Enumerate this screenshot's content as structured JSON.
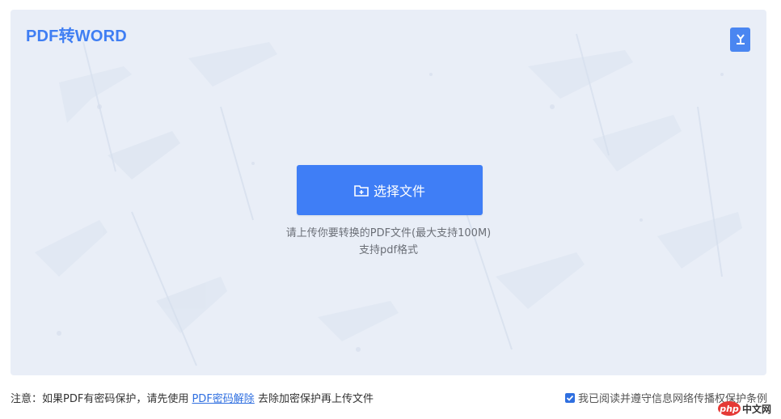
{
  "header": {
    "title": "PDF转WORD"
  },
  "upload": {
    "button_label": "选择文件",
    "hint_line1": "请上传你要转换的PDF文件(最大支持100M)",
    "hint_line2": "支持pdf格式"
  },
  "footer": {
    "notice_prefix": "注意：如果PDF有密码保护，请先使用",
    "notice_link": "PDF密码解除",
    "notice_suffix": "去除加密保护再上传文件",
    "agree_label": "我已阅读并遵守信息网络传播权保护条例",
    "agree_checked": true
  },
  "watermark": {
    "logo": "php",
    "text": "中文网"
  },
  "colors": {
    "accent": "#3f7ef6",
    "panel_bg": "#e9eef7",
    "link": "#2f6fe0"
  },
  "icons": {
    "corner": "download-icon",
    "button": "folder-add-icon"
  }
}
